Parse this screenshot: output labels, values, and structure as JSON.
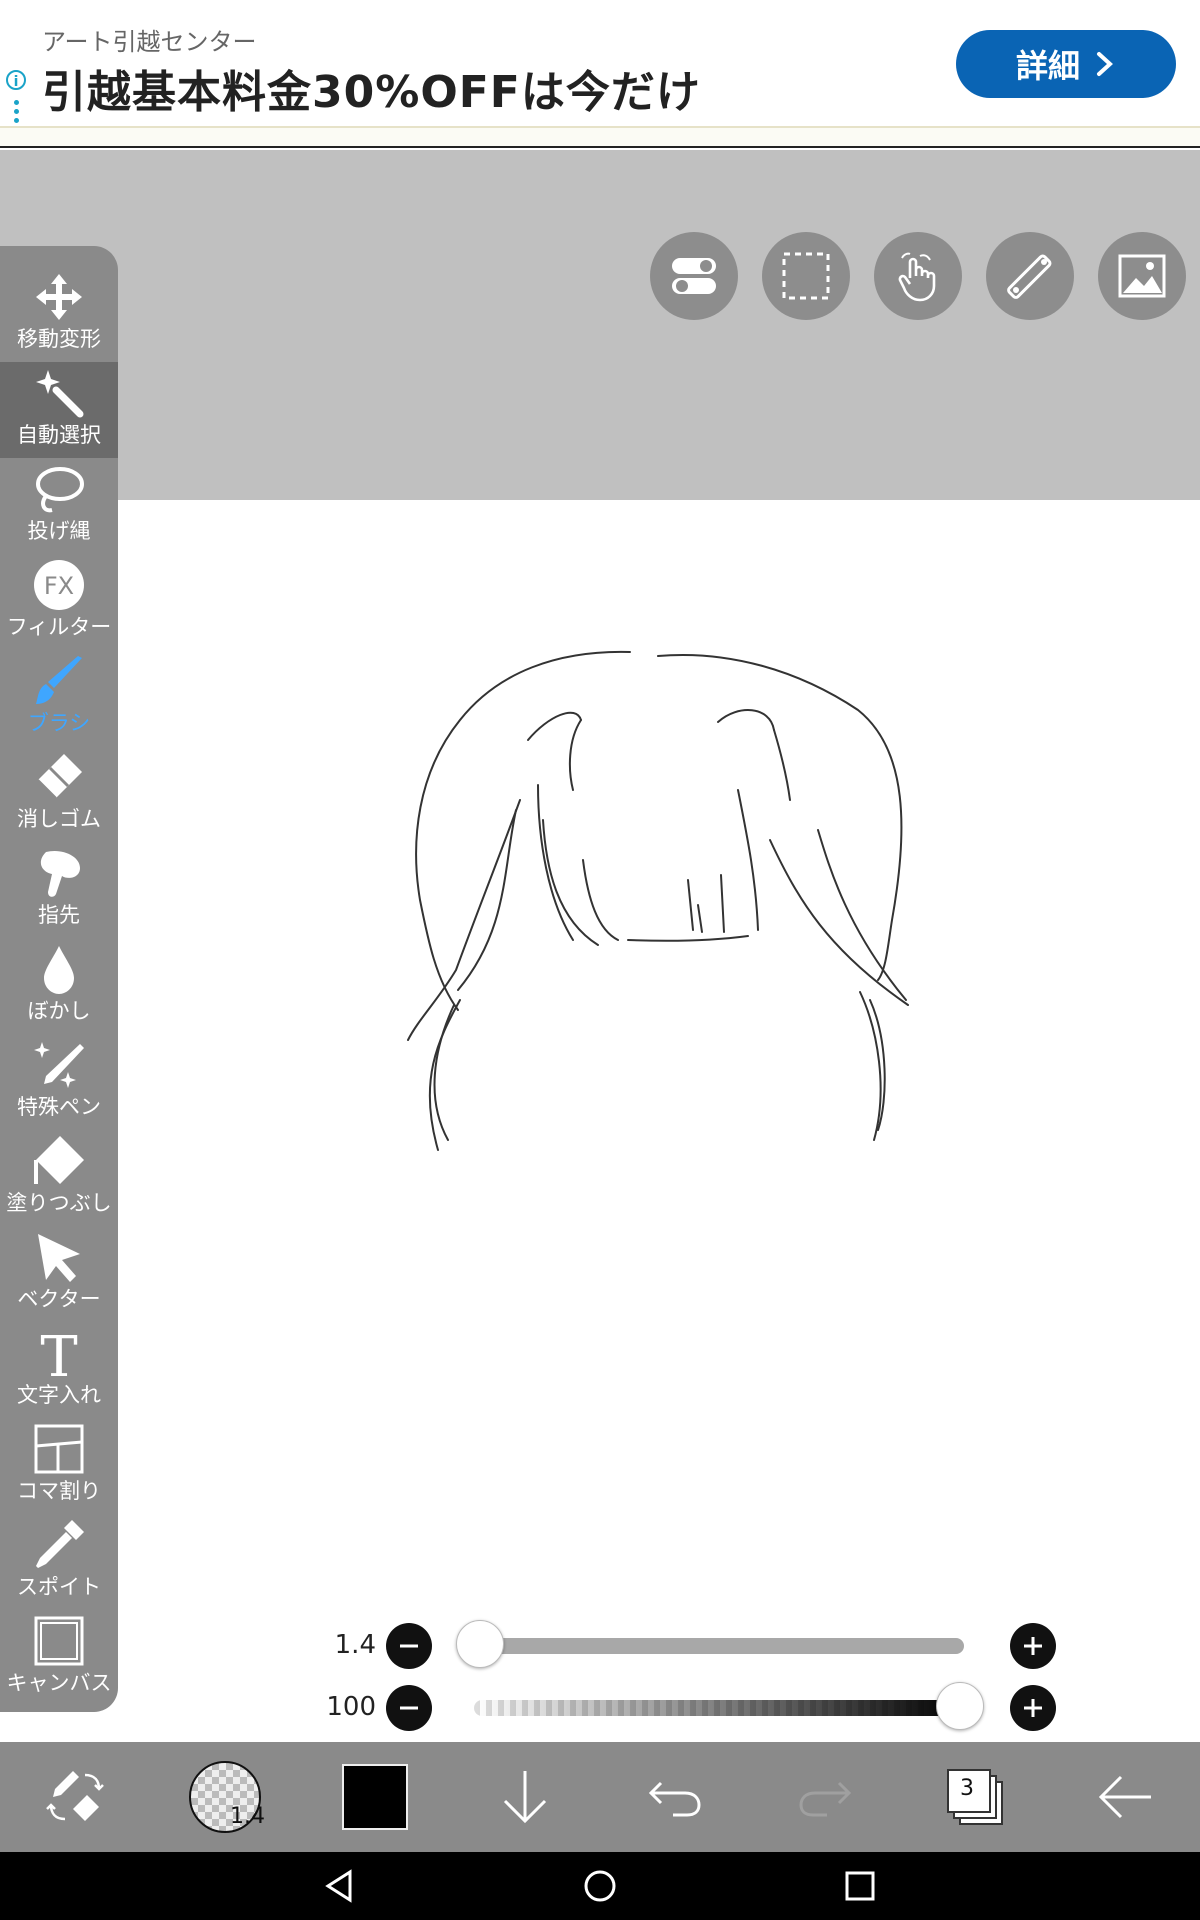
{
  "ad": {
    "advertiser": "アート引越センター",
    "headline": "引越基本料金30%OFFは今だけ",
    "cta_label": "詳細",
    "info_icon": "info-icon",
    "accent_color": "#0a64b4"
  },
  "top_tools": [
    {
      "name": "toggle-icon"
    },
    {
      "name": "selection-icon"
    },
    {
      "name": "hand-icon"
    },
    {
      "name": "ruler-icon"
    },
    {
      "name": "image-icon"
    }
  ],
  "toolbar": {
    "items": [
      {
        "label": "移動変形",
        "icon": "move-icon"
      },
      {
        "label": "自動選択",
        "icon": "magic-wand-icon"
      },
      {
        "label": "投げ縄",
        "icon": "lasso-icon"
      },
      {
        "label": "フィルター",
        "icon": "fx-icon"
      },
      {
        "label": "ブラシ",
        "icon": "brush-icon",
        "active": true
      },
      {
        "label": "消しゴム",
        "icon": "eraser-icon"
      },
      {
        "label": "指先",
        "icon": "finger-icon"
      },
      {
        "label": "ぼかし",
        "icon": "blur-drop-icon"
      },
      {
        "label": "特殊ペン",
        "icon": "special-pen-icon"
      },
      {
        "label": "塗りつぶし",
        "icon": "fill-icon"
      },
      {
        "label": "ベクター",
        "icon": "vector-arrow-icon"
      },
      {
        "label": "文字入れ",
        "icon": "text-icon"
      },
      {
        "label": "コマ割り",
        "icon": "panel-icon"
      },
      {
        "label": "スポイト",
        "icon": "eyedropper-icon"
      },
      {
        "label": "キャンバス",
        "icon": "canvas-icon"
      }
    ],
    "active_color": "#3fa6ff"
  },
  "sliders": {
    "size": {
      "value": "1.4",
      "fraction": 0.0
    },
    "opacity": {
      "value": "100",
      "fraction": 1.0
    }
  },
  "bottom_bar": {
    "brush_size": "1.4",
    "current_color": "#000000",
    "layer_count": "3"
  }
}
